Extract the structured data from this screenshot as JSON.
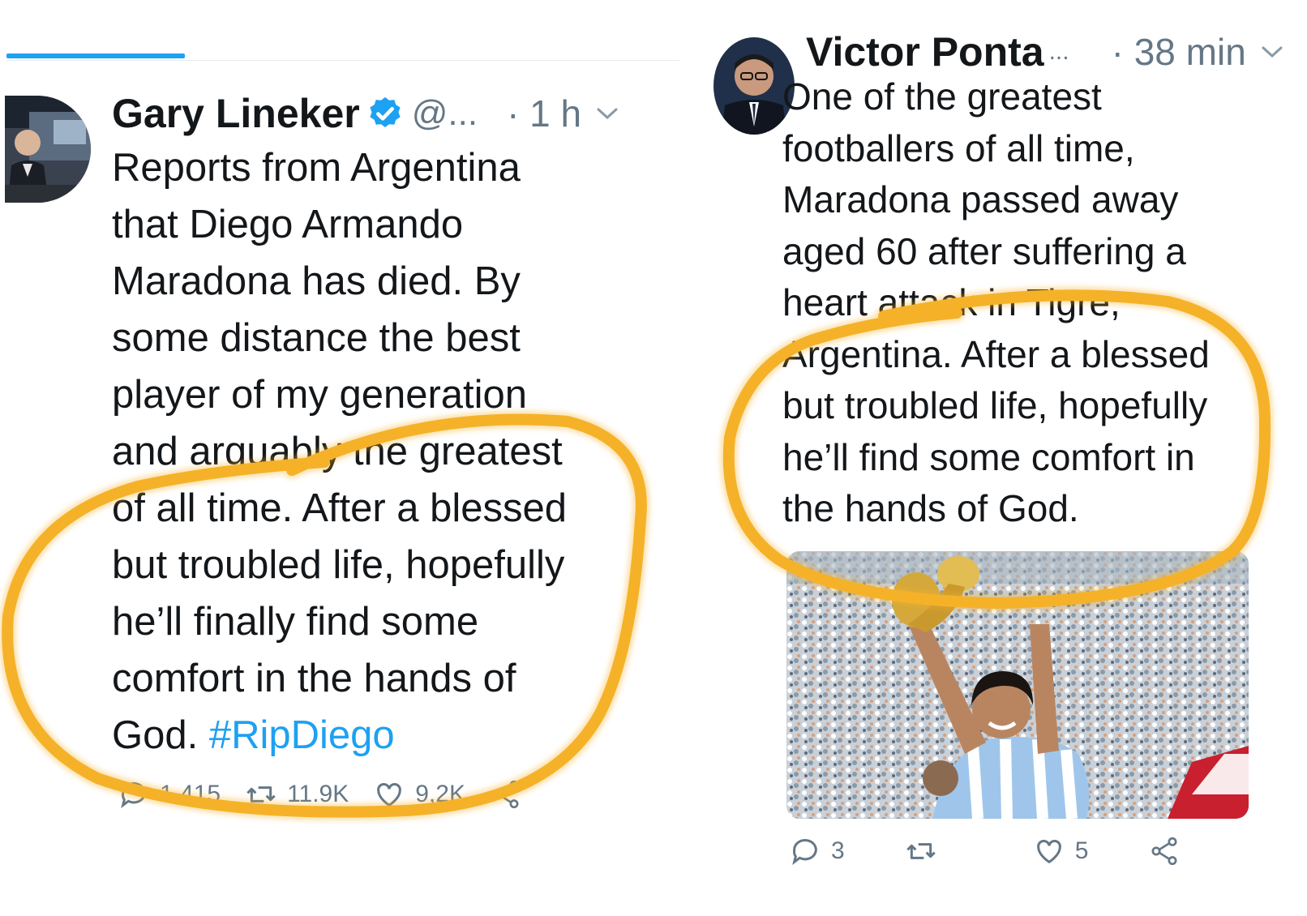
{
  "left_tweet": {
    "author_name": "Gary Lineker",
    "handle": "@...",
    "time": "· 1 h",
    "text_lines": [
      "Reports from Argentina",
      "that Diego Armando",
      "Maradona has died. By",
      "some distance the best",
      "player of my generation",
      "and arguably the greatest",
      "of all time. After a blessed",
      "but troubled life, hopefully",
      "he’ll finally find some",
      "comfort in the hands of"
    ],
    "last_line_text": "God.",
    "hashtag": "#RipDiego",
    "replies": "1.415",
    "retweets": "11.9K",
    "likes": "9,2K"
  },
  "right_tweet": {
    "author_name": "Victor Ponta",
    "handle": "...",
    "time": "· 38 min",
    "text_lines": [
      "One of the greatest",
      "footballers of all time,",
      "Maradona passed away",
      "aged 60 after suffering a",
      "heart attack in Tigre,",
      "Argentina. After a blessed",
      "but troubled life, hopefully",
      "he’ll find some comfort in",
      "the hands of God."
    ],
    "replies": "3",
    "likes": "5"
  },
  "colors": {
    "accent": "#1da1f2",
    "text": "#14171a",
    "muted": "#657786",
    "highlight_circle": "#f5b229"
  }
}
